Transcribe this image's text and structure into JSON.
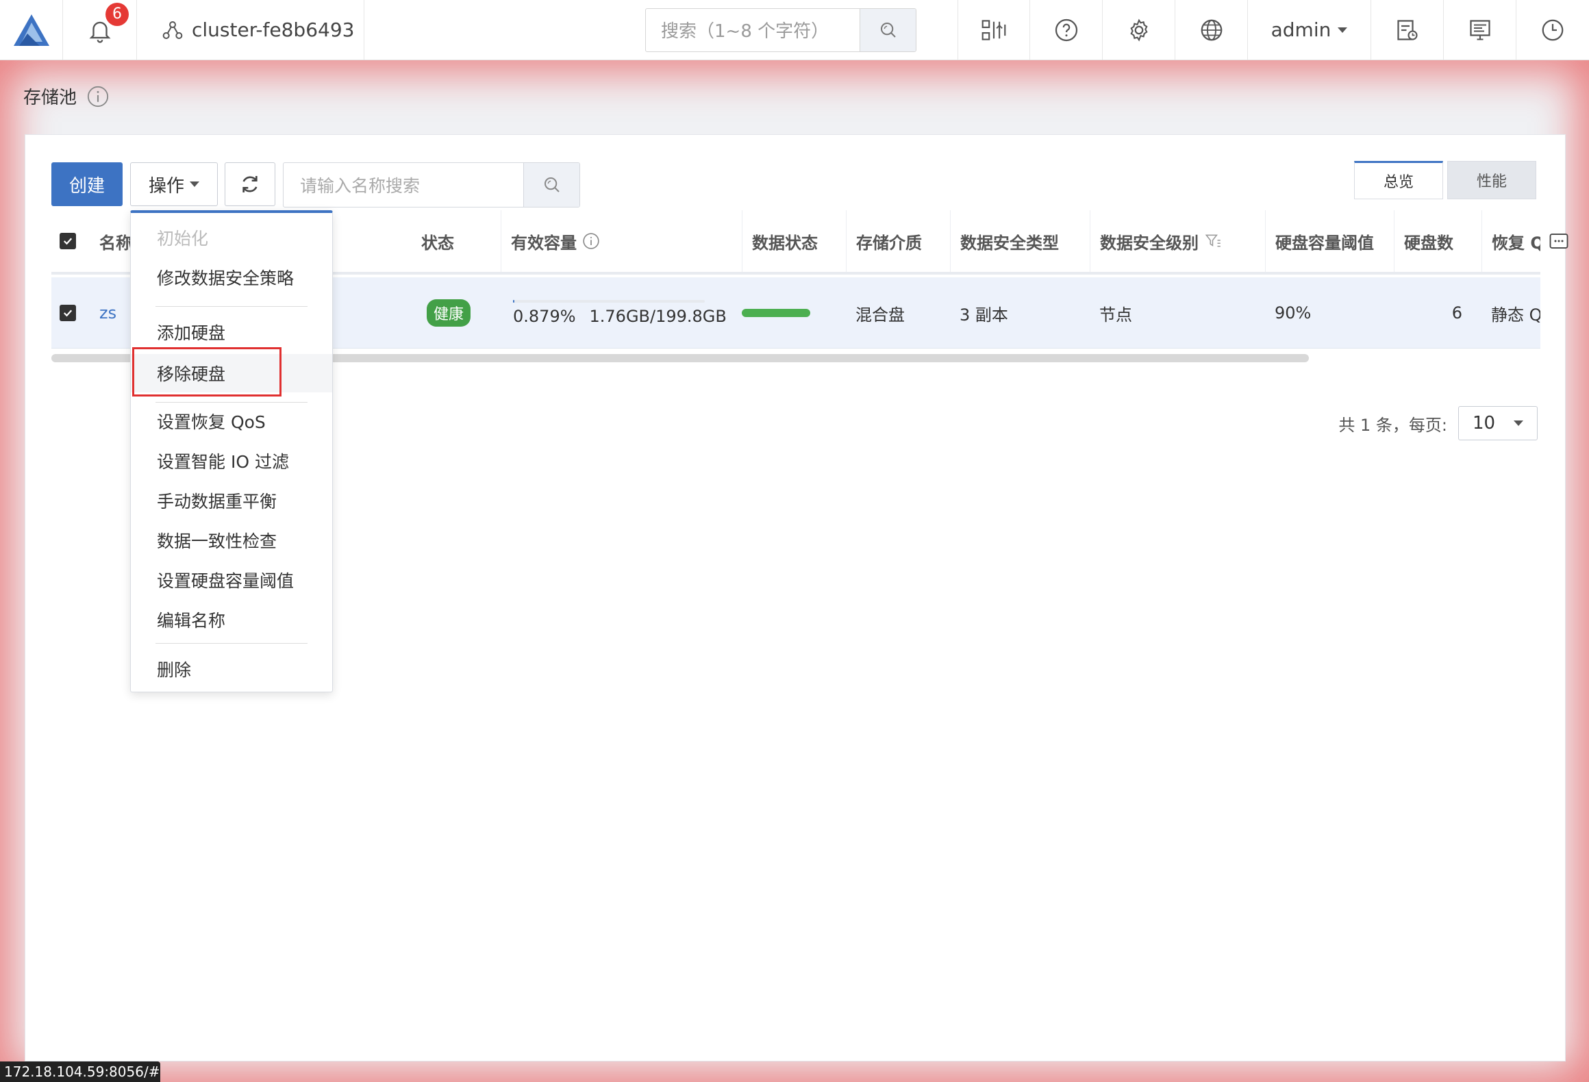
{
  "header": {
    "notification_count": "6",
    "cluster_name": "cluster-fe8b6493",
    "search_placeholder": "搜索（1~8 个字符）",
    "user": "admin"
  },
  "page": {
    "title": "存储池"
  },
  "toolbar": {
    "create_label": "创建",
    "operations_label": "操作",
    "search_placeholder": "请输入名称搜索"
  },
  "tabs": [
    {
      "label": "总览",
      "active": true
    },
    {
      "label": "性能",
      "active": false
    }
  ],
  "table": {
    "columns": [
      "名称",
      "状态",
      "有效容量",
      "数据状态",
      "存储介质",
      "数据安全类型",
      "数据安全级别",
      "硬盘容量阈值",
      "硬盘数",
      "恢复 Q"
    ],
    "rows": [
      {
        "name": "zs",
        "status": "健康",
        "capacity_percent": "0.879%",
        "capacity_usage": "1.76GB/199.8GB",
        "capacity_fraction": 0.00879,
        "medium": "混合盘",
        "safety_type": "3 副本",
        "safety_level": "节点",
        "disk_threshold": "90%",
        "disk_count": "6",
        "recovery": "静态 Qos"
      }
    ]
  },
  "pagination": {
    "total_text": "共 1 条，每页:",
    "page_size": "10"
  },
  "dropdown": {
    "items": [
      {
        "label": "初始化",
        "disabled": true
      },
      {
        "label": "修改数据安全策略"
      },
      {
        "label": "添加硬盘"
      },
      {
        "label": "移除硬盘",
        "highlighted": true
      },
      {
        "label": "设置恢复 QoS"
      },
      {
        "label": "设置智能 IO 过滤"
      },
      {
        "label": "手动数据重平衡"
      },
      {
        "label": "数据一致性检查"
      },
      {
        "label": "设置硬盘容量阈值"
      },
      {
        "label": "编辑名称"
      },
      {
        "label": "删除"
      }
    ]
  },
  "statusbar": {
    "url": "172.18.104.59:8056/#"
  },
  "colors": {
    "primary": "#3d73c3",
    "healthy": "#43a047",
    "highlight_border": "#e03030",
    "badge": "#e53935"
  }
}
